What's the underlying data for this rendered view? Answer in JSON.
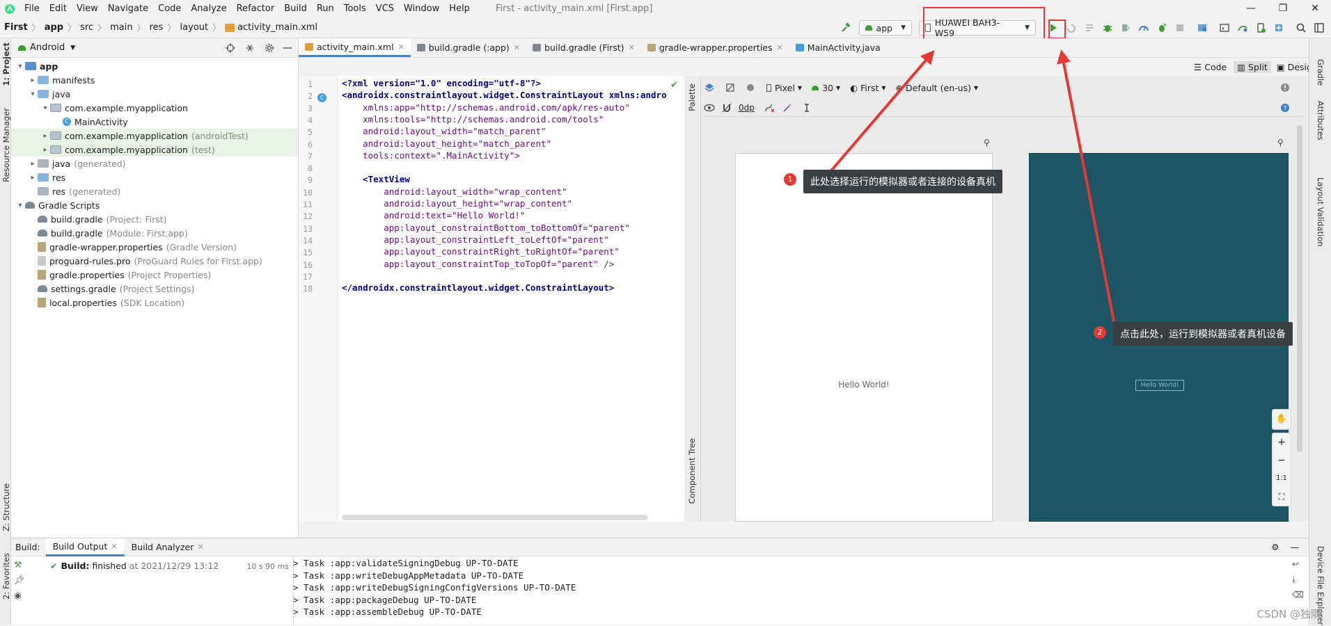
{
  "window": {
    "title": "First - activity_main.xml [First.app]",
    "menu": [
      "File",
      "Edit",
      "View",
      "Navigate",
      "Code",
      "Analyze",
      "Refactor",
      "Build",
      "Run",
      "Tools",
      "VCS",
      "Window",
      "Help"
    ],
    "controls": [
      "—",
      "❐",
      "✕"
    ]
  },
  "breadcrumb": [
    "First",
    "app",
    "src",
    "main",
    "res",
    "layout",
    "activity_main.xml"
  ],
  "toolbar": {
    "run_config": "app",
    "device": "HUAWEI BAH3-W59"
  },
  "project": {
    "view_mode": "Android",
    "tree": [
      {
        "label": "app",
        "note": "",
        "indent": 0,
        "arrow": "▾",
        "icon": "folder-app",
        "bold": true
      },
      {
        "label": "manifests",
        "note": "",
        "indent": 1,
        "arrow": "▸",
        "icon": "folder-blue"
      },
      {
        "label": "java",
        "note": "",
        "indent": 1,
        "arrow": "▾",
        "icon": "folder-blue"
      },
      {
        "label": "com.example.myapplication",
        "note": "",
        "indent": 2,
        "arrow": "▾",
        "icon": "package"
      },
      {
        "label": "MainActivity",
        "note": "",
        "indent": 3,
        "arrow": "",
        "icon": "class"
      },
      {
        "label": "com.example.myapplication",
        "note": "(androidTest)",
        "indent": 2,
        "arrow": "▸",
        "icon": "package",
        "selected": true
      },
      {
        "label": "com.example.myapplication",
        "note": "(test)",
        "indent": 2,
        "arrow": "▸",
        "icon": "package",
        "selected": true
      },
      {
        "label": "java",
        "note": "(generated)",
        "indent": 1,
        "arrow": "▸",
        "icon": "folder-gray"
      },
      {
        "label": "res",
        "note": "",
        "indent": 1,
        "arrow": "▸",
        "icon": "folder-blue"
      },
      {
        "label": "res",
        "note": "(generated)",
        "indent": 1,
        "arrow": "",
        "icon": "folder-gray"
      },
      {
        "label": "Gradle Scripts",
        "note": "",
        "indent": 0,
        "arrow": "▾",
        "icon": "gradle"
      },
      {
        "label": "build.gradle",
        "note": "(Project: First)",
        "indent": 1,
        "arrow": "",
        "icon": "gradle"
      },
      {
        "label": "build.gradle",
        "note": "(Module: First.app)",
        "indent": 1,
        "arrow": "",
        "icon": "gradle"
      },
      {
        "label": "gradle-wrapper.properties",
        "note": "(Gradle Version)",
        "indent": 1,
        "arrow": "",
        "icon": "props"
      },
      {
        "label": "proguard-rules.pro",
        "note": "(ProGuard Rules for First.app)",
        "indent": 1,
        "arrow": "",
        "icon": "file"
      },
      {
        "label": "gradle.properties",
        "note": "(Project Properties)",
        "indent": 1,
        "arrow": "",
        "icon": "props"
      },
      {
        "label": "settings.gradle",
        "note": "(Project Settings)",
        "indent": 1,
        "arrow": "",
        "icon": "gradle"
      },
      {
        "label": "local.properties",
        "note": "(SDK Location)",
        "indent": 1,
        "arrow": "",
        "icon": "props"
      }
    ]
  },
  "editor_tabs": [
    {
      "label": "activity_main.xml",
      "active": true
    },
    {
      "label": "build.gradle (:app)",
      "active": false
    },
    {
      "label": "build.gradle (First)",
      "active": false
    },
    {
      "label": "gradle-wrapper.properties",
      "active": false
    },
    {
      "label": "MainActivity.java",
      "active": false
    }
  ],
  "view_modes": [
    "Code",
    "Split",
    "Design"
  ],
  "code_lines": [
    "<?xml version=\"1.0\" encoding=\"utf-8\"?>",
    "<androidx.constraintlayout.widget.ConstraintLayout xmlns:andro",
    "    xmlns:app=\"http://schemas.android.com/apk/res-auto\"",
    "    xmlns:tools=\"http://schemas.android.com/tools\"",
    "    android:layout_width=\"match_parent\"",
    "    android:layout_height=\"match_parent\"",
    "    tools:context=\".MainActivity\">",
    "",
    "    <TextView",
    "        android:layout_width=\"wrap_content\"",
    "        android:layout_height=\"wrap_content\"",
    "        android:text=\"Hello World!\"",
    "        app:layout_constraintBottom_toBottomOf=\"parent\"",
    "        app:layout_constraintLeft_toLeftOf=\"parent\"",
    "        app:layout_constraintRight_toRightOf=\"parent\"",
    "        app:layout_constraintTop_toTopOf=\"parent\" />",
    "",
    "</androidx.constraintlayout.widget.ConstraintLayout>"
  ],
  "layout_toolbar": {
    "device": "Pixel",
    "api": "30",
    "theme": "First",
    "locale": "Default (en-us)",
    "margin": "0dp"
  },
  "preview": {
    "hello_text": "Hello World!",
    "blueprint_text": "Hello World!"
  },
  "side_tabs": {
    "palette": "Palette",
    "component_tree": "Component Tree",
    "left": [
      "1: Project",
      "Resource Manager",
      "Z: Structure",
      "2: Favorites"
    ],
    "right": [
      "Gradle",
      "Attributes",
      "Layout Validation",
      "Device File Explorer"
    ]
  },
  "annotations": [
    {
      "num": "1",
      "text": "此处选择运行的模拟器或者连接的设备真机"
    },
    {
      "num": "2",
      "text": "点击此处，运行到模拟器或者真机设备"
    }
  ],
  "build": {
    "label": "Build:",
    "tabs": [
      "Build Output",
      "Build Analyzer"
    ],
    "status_bold": "Build:",
    "status_text": "finished",
    "status_time": "at 2021/12/29 13:12",
    "duration": "10 s 90 ms",
    "console": [
      "> Task :app:validateSigningDebug UP-TO-DATE",
      "> Task :app:writeDebugAppMetadata UP-TO-DATE",
      "> Task :app:writeDebugSigningConfigVersions UP-TO-DATE",
      "> Task :app:packageDebug UP-TO-DATE",
      "> Task :app:assembleDebug UP-TO-DATE"
    ]
  },
  "watermark": "CSDN @独隅",
  "colors": {
    "accent": "#4083c9",
    "annotation_red": "#e53935",
    "blueprint": "#1d5565",
    "run_green": "#3f9c35"
  }
}
